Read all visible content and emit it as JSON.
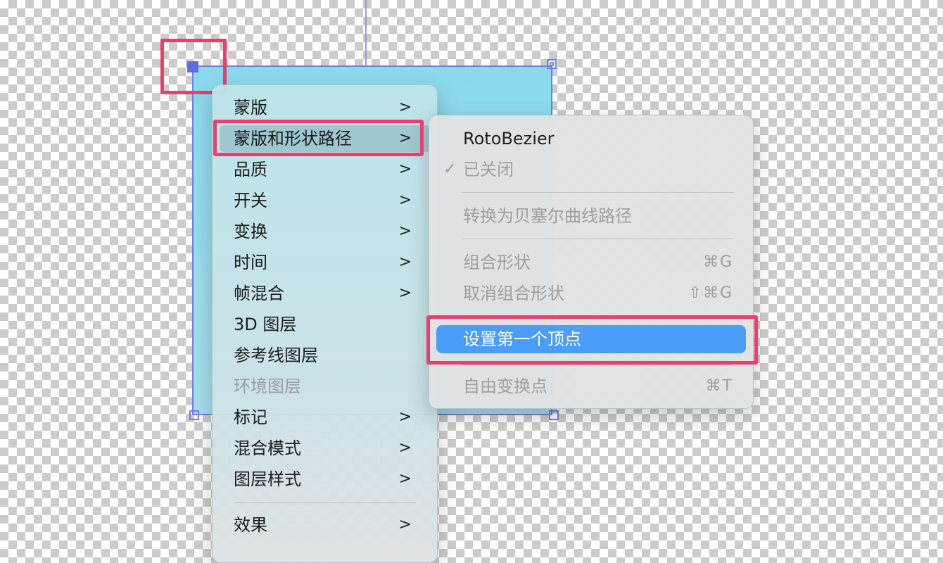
{
  "colors": {
    "accent_selection": "#4a9df8",
    "highlight_annotation": "#ec3e6d",
    "layer_fill": "#8ad9ee",
    "handle": "#5b6fe3"
  },
  "context_menu": {
    "items": [
      {
        "label": "蒙版",
        "submenu": true,
        "disabled": false
      },
      {
        "label": "蒙版和形状路径",
        "submenu": true,
        "disabled": false,
        "hover": true
      },
      {
        "label": "品质",
        "submenu": true,
        "disabled": false
      },
      {
        "label": "开关",
        "submenu": true,
        "disabled": false
      },
      {
        "label": "变换",
        "submenu": true,
        "disabled": false
      },
      {
        "label": "时间",
        "submenu": true,
        "disabled": false
      },
      {
        "label": "帧混合",
        "submenu": true,
        "disabled": false
      },
      {
        "label": "3D 图层",
        "submenu": false,
        "disabled": false
      },
      {
        "label": "参考线图层",
        "submenu": false,
        "disabled": false
      },
      {
        "label": "环境图层",
        "submenu": false,
        "disabled": true
      },
      {
        "label": "标记",
        "submenu": true,
        "disabled": false
      },
      {
        "label": "混合模式",
        "submenu": true,
        "disabled": false
      },
      {
        "label": "图层样式",
        "submenu": true,
        "disabled": false
      },
      {
        "label": "效果",
        "submenu": true,
        "disabled": false
      }
    ],
    "chevron": ">"
  },
  "submenu": {
    "items": [
      {
        "label": "RotoBezier",
        "disabled": false
      },
      {
        "label": "已关闭",
        "disabled": true,
        "checked": true,
        "check_glyph": "✓"
      },
      {
        "label": "转换为贝塞尔曲线路径",
        "disabled": true
      },
      {
        "label": "组合形状",
        "disabled": true,
        "shortcut": "⌘G"
      },
      {
        "label": "取消组合形状",
        "disabled": true,
        "shortcut": "⇧⌘G"
      },
      {
        "label": "设置第一个顶点",
        "disabled": false,
        "selected": true
      },
      {
        "label": "自由变换点",
        "disabled": true,
        "shortcut": "⌘T"
      }
    ]
  }
}
